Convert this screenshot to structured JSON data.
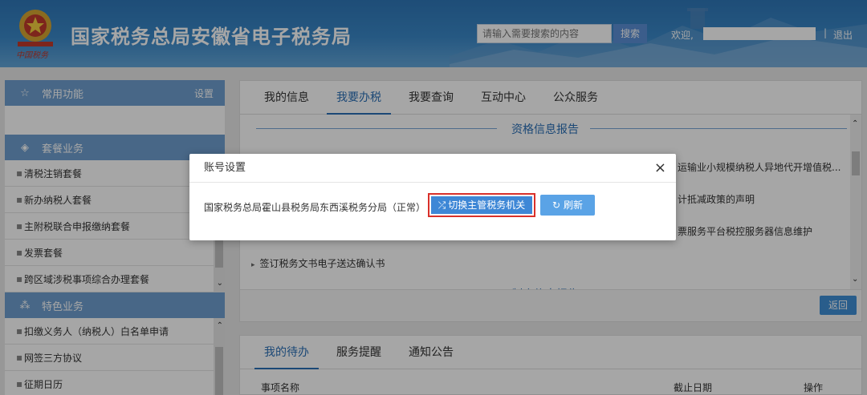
{
  "header": {
    "title": "国家税务总局安徽省电子税务局",
    "logo_text": "中国税务",
    "search_placeholder": "请输入需要搜索的内容",
    "search_button": "搜索",
    "welcome": "欢迎,",
    "separator": "|",
    "logout": "退出"
  },
  "sidebar": {
    "common_title": "常用功能",
    "common_setting": "设置",
    "package_title": "套餐业务",
    "package_items": [
      "清税注销套餐",
      "新办纳税人套餐",
      "主附税联合申报缴纳套餐",
      "发票套餐",
      "跨区域涉税事项综合办理套餐"
    ],
    "special_title": "特色业务",
    "special_items": [
      "扣缴义务人（纳税人）白名单申请",
      "网签三方协议",
      "征期日历"
    ]
  },
  "main": {
    "tabs": [
      "我的信息",
      "我要办税",
      "我要查询",
      "互动中心",
      "公众服务"
    ],
    "active_tab": "我要办税",
    "section1": "资格信息报告",
    "row1": "运输业小规模纳税人异地代开增值税...",
    "row2": "计抵减政策的声明",
    "row3": "票服务平台税控服务器信息维护",
    "row4": "签订税务文书电子送达确认书",
    "section2": "制度信息报告",
    "back_button": "返回"
  },
  "bottom": {
    "tabs": [
      "我的待办",
      "服务提醒",
      "通知公告"
    ],
    "col_name": "事项名称",
    "col_deadline": "截止日期",
    "col_action": "操作"
  },
  "modal": {
    "title": "账号设置",
    "close": "×",
    "org": "国家税务总局霍山县税务局东西溪税务分局（正常）",
    "switch_button": "切换主管税务机关",
    "refresh_button": "刷新"
  },
  "colors": {
    "header_blue": "#3a88c8",
    "accent_blue": "#2a6fb6",
    "highlight_red": "#d9302a"
  }
}
